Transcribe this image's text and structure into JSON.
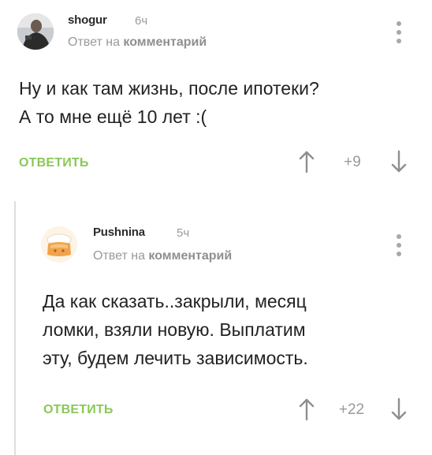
{
  "comments": [
    {
      "author": "shogur",
      "time": "6ч",
      "reply_prefix": "Ответ на",
      "reply_target": "комментарий",
      "text_lines": [
        "Ну и как там жизнь, после ипотеки?",
        "А то мне ещё 10 лет :("
      ],
      "reply_label": "ОТВЕТИТЬ",
      "rating": "+9"
    },
    {
      "author": "Pushnina",
      "time": "5ч",
      "reply_prefix": "Ответ на",
      "reply_target": "комментарий",
      "text_lines": [
        "Да как сказать..закрыли, месяц",
        "ломки, взяли новую. Выплатим",
        "эту, будем лечить зависимость."
      ],
      "reply_label": "ОТВЕТИТЬ",
      "rating": "+22"
    }
  ],
  "colors": {
    "accent_green": "#8ac858",
    "muted_gray": "#9a9a9a",
    "text": "#222222",
    "thread_line": "#dedede"
  },
  "icons": {
    "vote_up": "arrow-up-icon",
    "vote_down": "arrow-down-icon",
    "more": "more-vertical-icon"
  }
}
